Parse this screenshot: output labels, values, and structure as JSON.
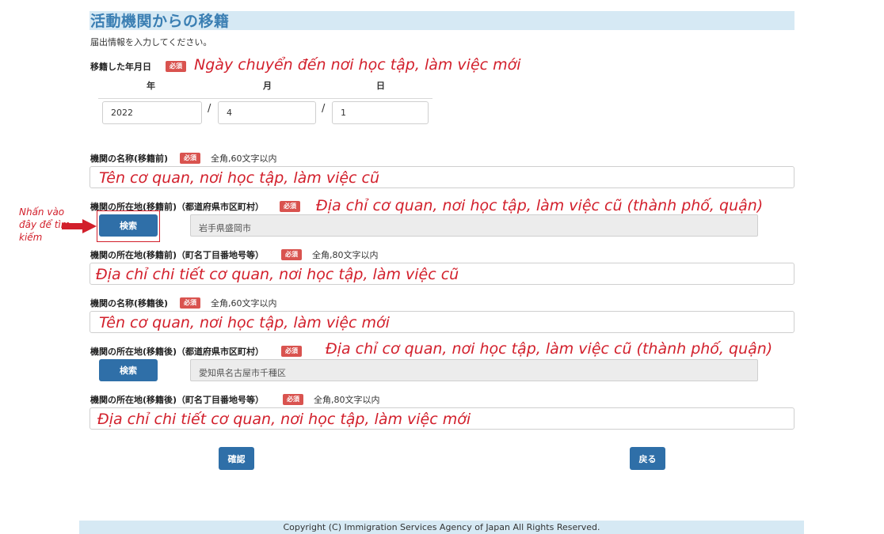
{
  "page": {
    "title": "活動機関からの移籍",
    "subtitle": "届出情報を入力してください。"
  },
  "required_label": "必須",
  "move_date": {
    "label": "移籍した年月日",
    "note": "Ngày chuyển đến nơi học tập, làm việc mới",
    "year_header": "年",
    "month_header": "月",
    "day_header": "日",
    "year": "2022",
    "month": "4",
    "day": "1",
    "separator": "/"
  },
  "org_before": {
    "label": "機関の名称(移籍前)",
    "hint": "全角,60文字以内",
    "note": "Tên cơ quan, nơi học tập, làm việc cũ"
  },
  "addr_before_city": {
    "label": "機関の所在地(移籍前)（都道府県市区町村）",
    "note": "Địa chỉ cơ quan, nơi học tập, làm việc cũ (thành phố, quận)",
    "search_label": "検索",
    "value": "岩手県盛岡市"
  },
  "side_note": "Nhấn vào đây để tìm kiếm",
  "addr_before_detail": {
    "label": "機関の所在地(移籍前)（町名丁目番地号等）",
    "hint": "全角,80文字以内",
    "note": "Địa chỉ chi tiết cơ quan, nơi học tập, làm việc cũ"
  },
  "org_after": {
    "label": "機関の名称(移籍後)",
    "hint": "全角,60文字以内",
    "note": "Tên cơ quan, nơi học tập, làm việc mới"
  },
  "addr_after_city": {
    "label": "機関の所在地(移籍後)（都道府県市区町村）",
    "note": "Địa chỉ cơ quan, nơi học tập, làm việc cũ (thành phố, quận)",
    "search_label": "検索",
    "value": "愛知県名古屋市千種区"
  },
  "addr_after_detail": {
    "label": "機関の所在地(移籍後)（町名丁目番地号等）",
    "hint": "全角,80文字以内",
    "note": "Địa chỉ chi tiết cơ quan, nơi học tập, làm việc mới"
  },
  "actions": {
    "confirm": "確認",
    "back": "戻る"
  },
  "footer": "Copyright (C) Immigration Services Agency of Japan All Rights Reserved.",
  "colors": {
    "accent": "#2f6fa8",
    "required": "#d9534f",
    "annotation": "#d21f2b",
    "header_bg": "#d6e9f4"
  }
}
